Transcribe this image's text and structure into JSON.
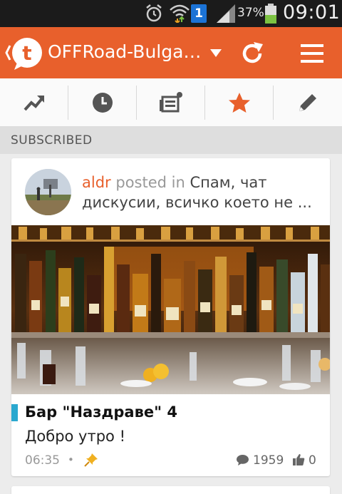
{
  "status_bar": {
    "battery_percent": "37%",
    "time": "09:01",
    "sim_badge": "1",
    "icons": [
      "alarm-icon",
      "wifi-icon",
      "sim-icon",
      "signal-icon",
      "battery-icon"
    ]
  },
  "action_bar": {
    "forum_title": "OFFRoad-Bulga…",
    "icons": [
      "back-chevron-icon",
      "tapatalk-logo-icon",
      "dropdown-arrow-icon",
      "refresh-icon",
      "menu-icon"
    ],
    "accent_color": "#e8602c"
  },
  "tabs": [
    {
      "name": "trending",
      "icon": "trending-icon"
    },
    {
      "name": "timeline",
      "icon": "clock-icon"
    },
    {
      "name": "feed",
      "icon": "news-icon"
    },
    {
      "name": "subscribed",
      "icon": "star-icon",
      "active": true
    },
    {
      "name": "compose",
      "icon": "pencil-icon"
    }
  ],
  "section": {
    "label": "SUBSCRIBED"
  },
  "post": {
    "author": "aldr",
    "posted_in": "posted in",
    "forum": "Спам, чат дискусии, всичко което не ...",
    "topic_title": "Бар \"Наздраве\" 4",
    "excerpt": "Добро утро !",
    "time": "06:35",
    "separator": "•",
    "comments": "1959",
    "likes": "0",
    "accent_color": "#2aa8cf"
  }
}
